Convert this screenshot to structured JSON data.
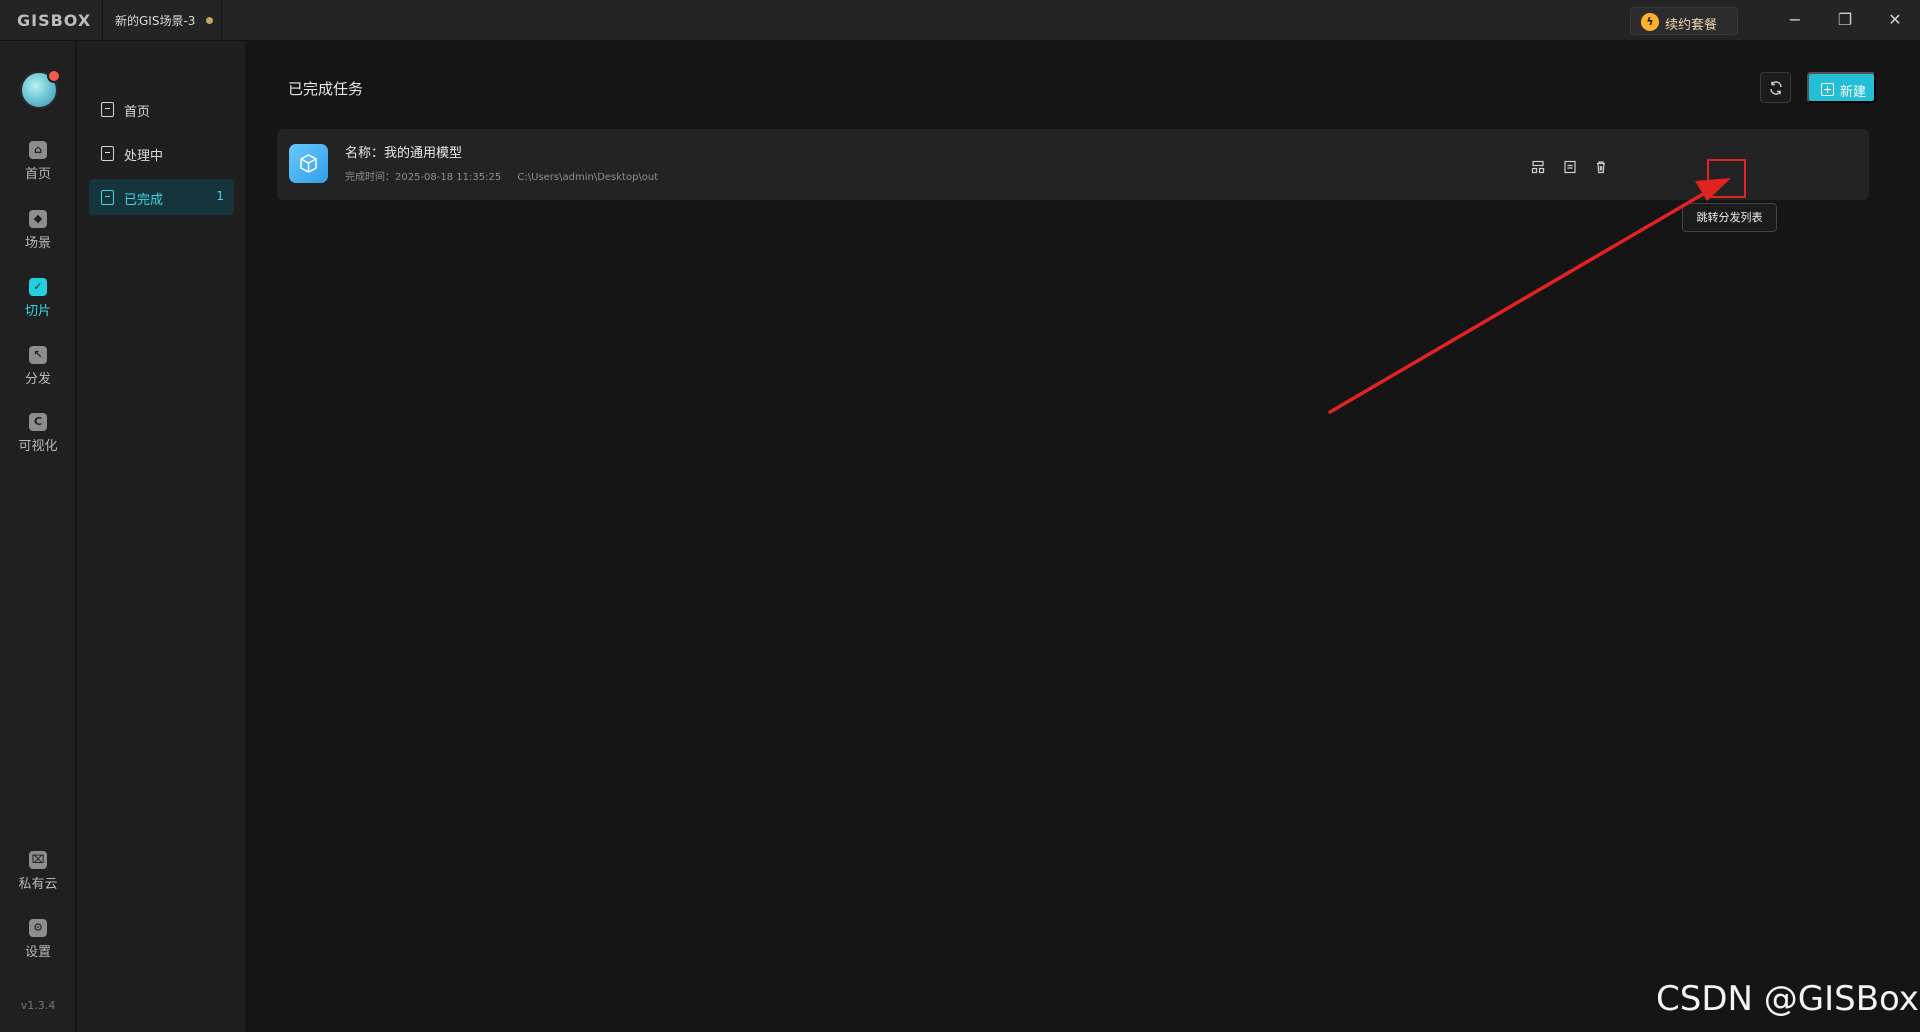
{
  "titlebar": {
    "logo": "GISBOX",
    "tab_label": "新的GIS场景-3",
    "renew_label": "续约套餐",
    "window_controls": {
      "minimize": "−",
      "restore": "❐",
      "close": "✕"
    }
  },
  "rail": {
    "items": [
      {
        "label": "首页"
      },
      {
        "label": "场景"
      },
      {
        "label": "切片"
      },
      {
        "label": "分发"
      },
      {
        "label": "可视化"
      },
      {
        "label": "私有云"
      },
      {
        "label": "设置"
      }
    ],
    "version": "v1.3.4"
  },
  "submenu": {
    "items": [
      {
        "label": "首页",
        "count": ""
      },
      {
        "label": "处理中",
        "count": ""
      },
      {
        "label": "已完成",
        "count": "1"
      }
    ]
  },
  "main": {
    "title": "已完成任务",
    "new_label": "新建",
    "task": {
      "name": "名称：我的通用模型",
      "completed_time": "完成时间：2025-08-18 11:35:25",
      "path": "C:\\Users\\admin\\Desktop\\out"
    },
    "tooltip": "跳转分发列表"
  },
  "watermark": "CSDN @GISBox",
  "colors": {
    "accent": "#24bfd7",
    "highlight": "#e32222"
  }
}
